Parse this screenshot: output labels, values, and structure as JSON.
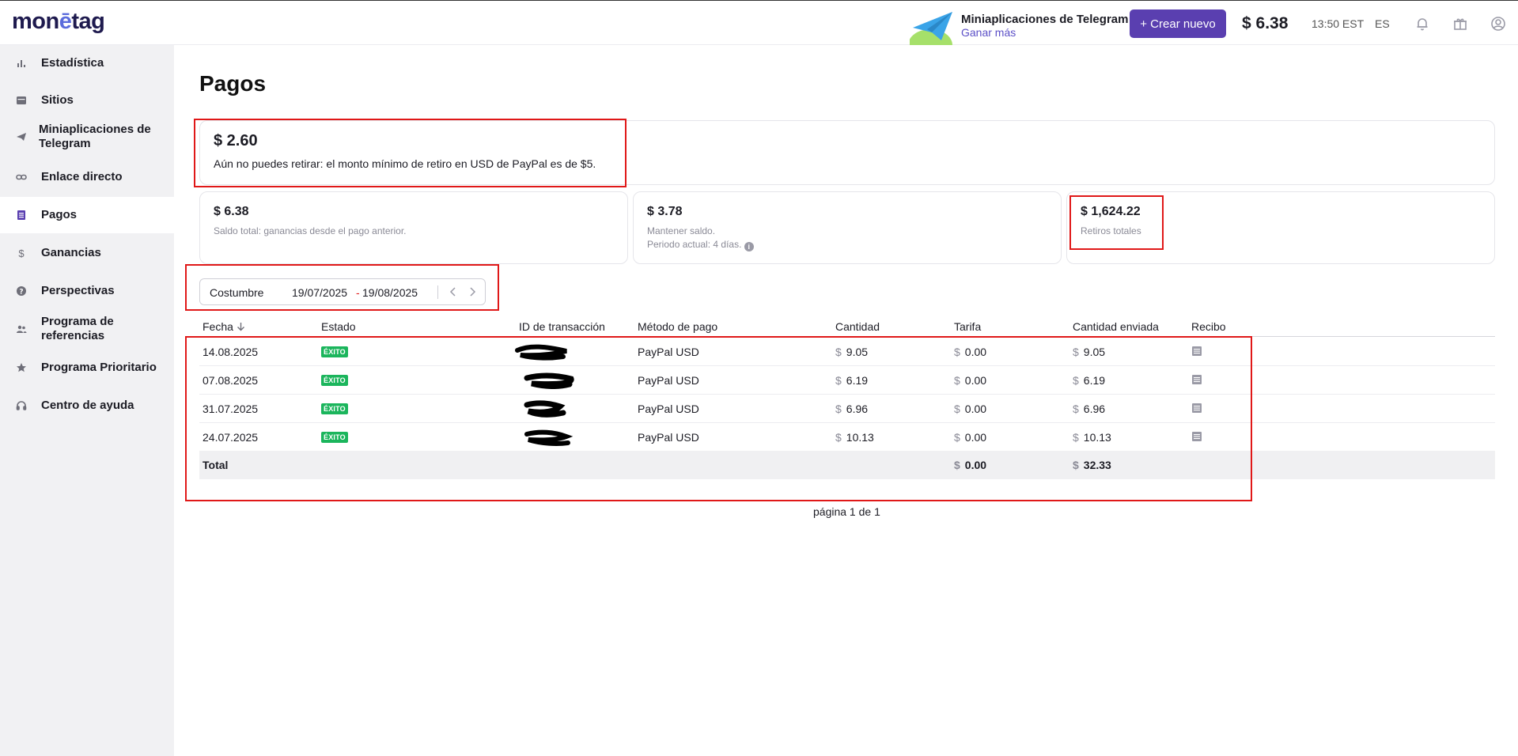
{
  "header": {
    "logo": {
      "part1": "mon",
      "part2": "ē",
      "part3": "tag"
    },
    "telegram_promo": {
      "title": "Miniaplicaciones de Telegram",
      "link": "Ganar más"
    },
    "create_button": "+ Crear nuevo",
    "balance": "$ 6.38",
    "time": "13:50 EST",
    "language": "ES",
    "icons": [
      "bell-icon",
      "gift-icon",
      "user-icon"
    ]
  },
  "sidebar": {
    "items": [
      {
        "label": "Estadística",
        "icon": "chart-icon"
      },
      {
        "label": "Sitios",
        "icon": "sites-icon"
      },
      {
        "label": "Miniaplicaciones de Telegram",
        "icon": "telegram-icon"
      },
      {
        "label": "Enlace directo",
        "icon": "link-icon"
      },
      {
        "label": "Pagos",
        "icon": "payments-icon",
        "active": true
      },
      {
        "label": "Ganancias",
        "icon": "dollar-icon"
      },
      {
        "label": "Perspectivas",
        "icon": "question-icon"
      },
      {
        "label": "Programa de referencias",
        "icon": "users-icon"
      },
      {
        "label": "Programa Prioritario",
        "icon": "star-icon"
      },
      {
        "label": "Centro de ayuda",
        "icon": "headset-icon"
      }
    ]
  },
  "main": {
    "title": "Pagos",
    "withdraw_card": {
      "amount": "$ 2.60",
      "note": "Aún no puedes retirar: el monto mínimo de retiro en USD de PayPal es de $5."
    },
    "stat_cards": [
      {
        "amount": "$ 6.38",
        "line1": "Saldo total: ganancias desde el pago anterior.",
        "line2": ""
      },
      {
        "amount": "$ 3.78",
        "line1": "Mantener saldo.",
        "line2": "Periodo actual: 4 días."
      },
      {
        "amount": "$ 1,624.22",
        "line1": "Retiros totales",
        "line2": ""
      }
    ],
    "date_filter": {
      "label": "Costumbre",
      "from": "19/07/2025",
      "separator": "-",
      "to": "19/08/2025"
    },
    "table": {
      "columns": [
        "Fecha",
        "Estado",
        "ID de transacción",
        "Método de pago",
        "Cantidad",
        "Tarifa",
        "Cantidad enviada",
        "Recibo"
      ],
      "rows": [
        {
          "date": "14.08.2025",
          "status": "ÉXITO",
          "method": "PayPal USD",
          "amount": "9.05",
          "fee": "0.00",
          "sent": "9.05"
        },
        {
          "date": "07.08.2025",
          "status": "ÉXITO",
          "method": "PayPal USD",
          "amount": "6.19",
          "fee": "0.00",
          "sent": "6.19"
        },
        {
          "date": "31.07.2025",
          "status": "ÉXITO",
          "method": "PayPal USD",
          "amount": "6.96",
          "fee": "0.00",
          "sent": "6.96"
        },
        {
          "date": "24.07.2025",
          "status": "ÉXITO",
          "method": "PayPal USD",
          "amount": "10.13",
          "fee": "0.00",
          "sent": "10.13"
        }
      ],
      "total": {
        "label": "Total",
        "fee": "0.00",
        "sent": "32.33"
      },
      "currency": "$"
    },
    "pager": "página 1 de 1"
  },
  "colors": {
    "accent": "#5a3fb0",
    "success": "#1bb55c",
    "highlight": "#e01818"
  }
}
